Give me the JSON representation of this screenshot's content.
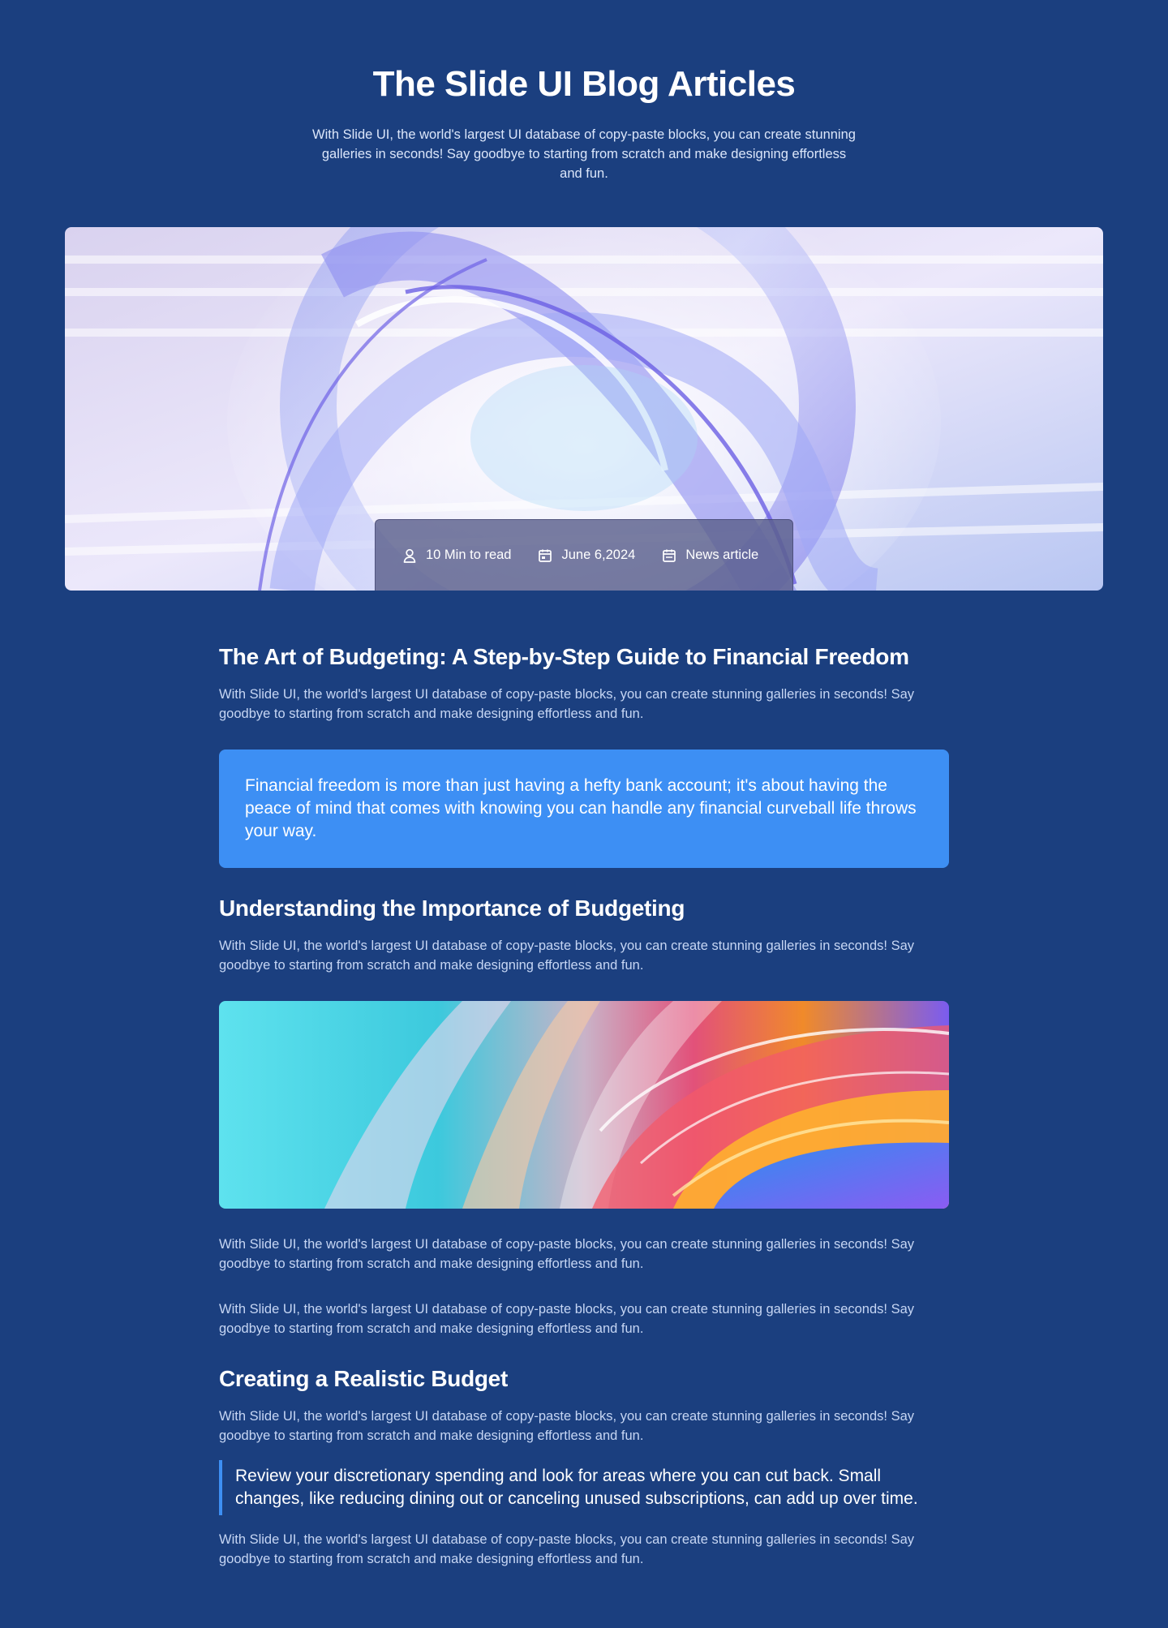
{
  "header": {
    "title": "The Slide UI Blog Articles",
    "subtitle": "With Slide UI, the world's largest UI database of copy-paste blocks, you can create stunning galleries in seconds! Say goodbye to starting from scratch and make designing effortless and fun."
  },
  "hero": {
    "image_alt": "abstract glass swirl",
    "meta": {
      "read_time": "10 Min to read",
      "date": "June 6,2024",
      "category": "News article",
      "icons": [
        "user-icon",
        "calendar-icon",
        "calendar-icon"
      ]
    }
  },
  "article": {
    "title": "The Art of Budgeting: A Step-by-Step Guide to Financial Freedom",
    "intro": "With Slide UI, the world's largest UI database of copy-paste blocks, you can create stunning galleries in seconds! Say goodbye to starting from scratch and make designing effortless and fun.",
    "callout": "Financial freedom is more than just having a hefty bank account; it's about having the peace of mind that comes with knowing you can handle any financial curveball life throws your way.",
    "section1": {
      "heading": "Understanding the Importance of Budgeting",
      "paragraph": "With Slide UI, the world's largest UI database of copy-paste blocks, you can create stunning galleries in seconds! Say goodbye to starting from scratch and make designing effortless and fun.",
      "image_alt": "colorful abstract glass waves",
      "paragraph2": "With Slide UI, the world's largest UI database of copy-paste blocks, you can create stunning galleries in seconds! Say goodbye to starting from scratch and make designing effortless and fun.",
      "paragraph3": "With Slide UI, the world's largest UI database of copy-paste blocks, you can create stunning galleries in seconds! Say goodbye to starting from scratch and make designing effortless and fun."
    },
    "section2": {
      "heading": "Creating a Realistic Budget",
      "paragraph": "With Slide UI, the world's largest UI database of copy-paste blocks, you can create stunning galleries in seconds! Say goodbye to starting from scratch and make designing effortless and fun.",
      "quote": "Review your discretionary spending and look for areas where you can cut back. Small changes, like reducing dining out or canceling unused subscriptions, can add up over time.",
      "paragraph2": "With Slide UI, the world's largest UI database of copy-paste blocks, you can create stunning galleries in seconds! Say goodbye to starting from scratch and make designing effortless and fun."
    }
  },
  "colors": {
    "background": "#1b3f7f",
    "accent": "#3d8ff4",
    "heading": "#ffffff",
    "body_text": "#c6d6f4"
  }
}
